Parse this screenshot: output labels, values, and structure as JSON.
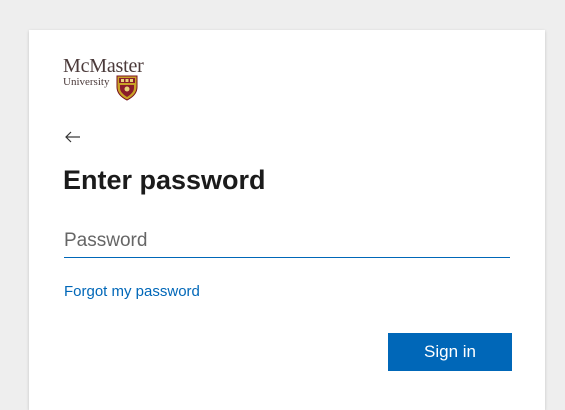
{
  "logo": {
    "name": "McMaster",
    "subtitle": "University",
    "crest_icon": "university-crest-icon",
    "crest_colors": {
      "shield": "#c9a227",
      "field": "#8a1c2b",
      "accent": "#7a1020"
    }
  },
  "back": {
    "icon": "arrow-left-icon"
  },
  "title": "Enter password",
  "password": {
    "value": "",
    "placeholder": "Password"
  },
  "forgot_link": "Forgot my password",
  "signin_button": "Sign in",
  "colors": {
    "accent": "#0067b8",
    "text": "#1b1b1b",
    "background": "#ffffff"
  }
}
